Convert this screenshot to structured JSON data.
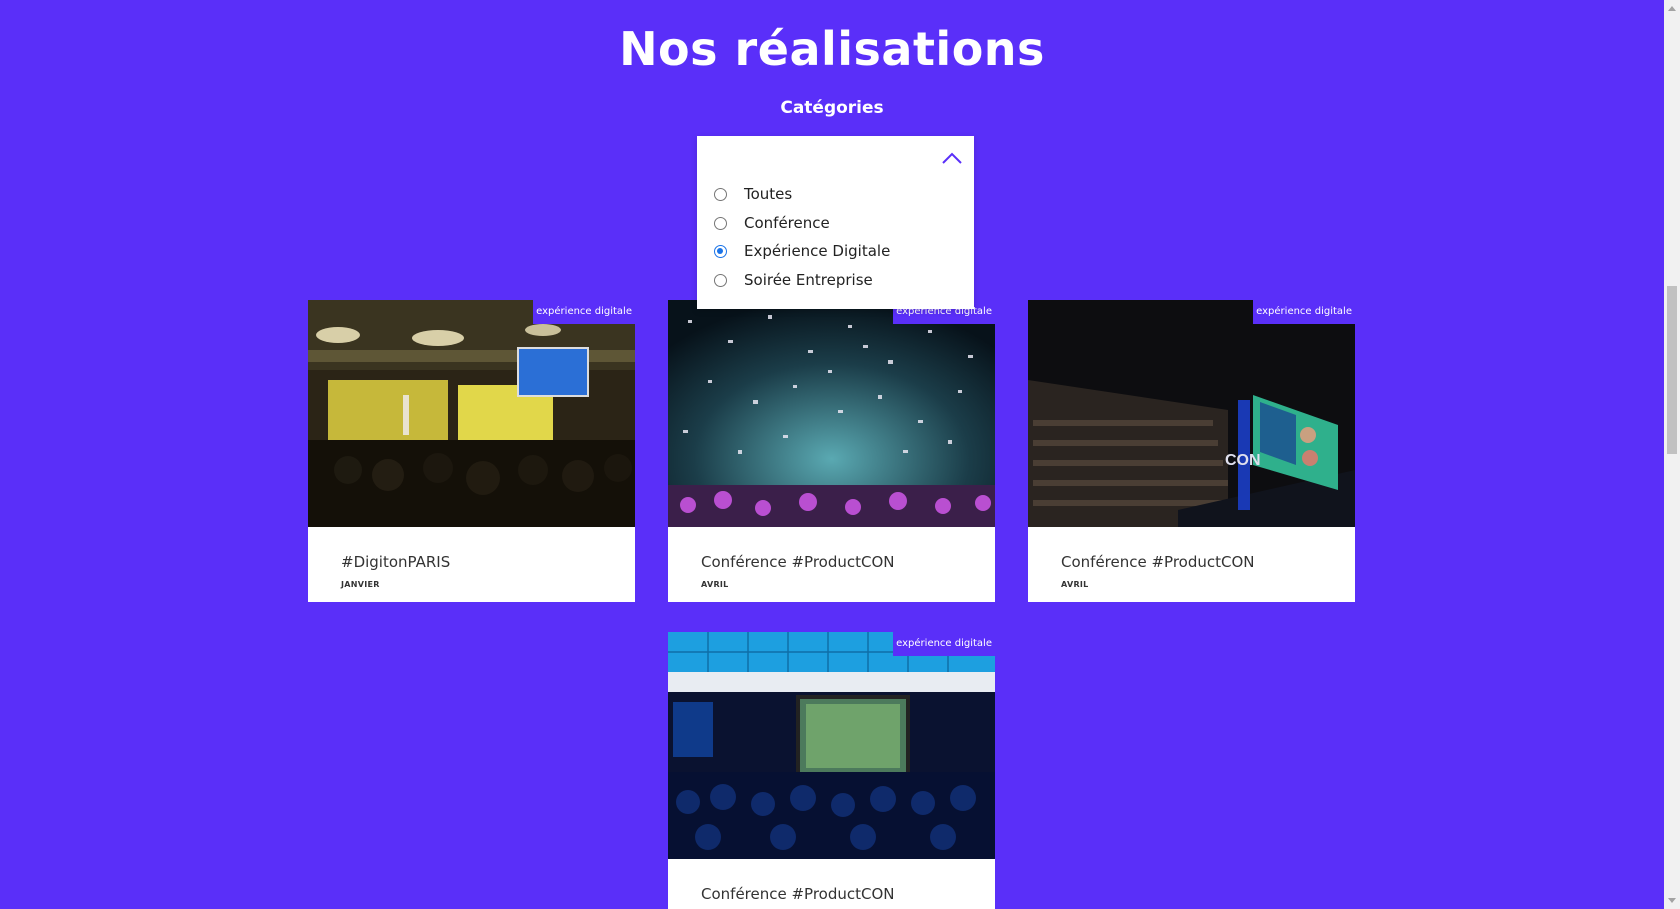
{
  "header": {
    "title": "Nos réalisations",
    "categories_label": "Catégories"
  },
  "filter": {
    "options": [
      {
        "label": "Toutes",
        "checked": false
      },
      {
        "label": "Conférence",
        "checked": false
      },
      {
        "label": "Expérience Digitale",
        "checked": true
      },
      {
        "label": "Soirée Entreprise",
        "checked": false
      }
    ]
  },
  "cards": [
    {
      "tag": "expérience digitale",
      "title": "#DigitonPARIS",
      "date": "JANVIER"
    },
    {
      "tag": "expérience digitale",
      "title": "Conférence #ProductCON",
      "date": "AVRIL"
    },
    {
      "tag": "expérience digitale",
      "title": "Conférence #ProductCON",
      "date": "AVRIL"
    },
    {
      "tag": "expérience digitale",
      "title": "Conférence #ProductCON",
      "date": ""
    }
  ],
  "colors": {
    "background": "#5a2ff9",
    "radio_checked": "#1a73e8"
  }
}
